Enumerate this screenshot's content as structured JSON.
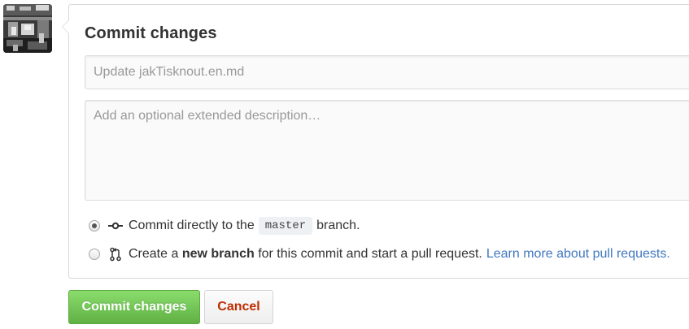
{
  "avatar": {
    "alt_icon": "user-avatar-photo"
  },
  "commit_form": {
    "title": "Commit changes",
    "summary_placeholder": "Update jakTisknout.en.md",
    "description_placeholder": "Add an optional extended description…",
    "options": [
      {
        "icon": "git-commit-icon",
        "selected": true,
        "text_before": "Commit directly to the",
        "branch_name": "master",
        "text_after": "branch."
      },
      {
        "icon": "git-pull-request-icon",
        "selected": false,
        "text_before": "Create a",
        "bold_text": "new branch",
        "text_after": "for this commit and start a pull request.",
        "link_text": "Learn more about pull requests."
      }
    ]
  },
  "buttons": {
    "commit_label": "Commit changes",
    "cancel_label": "Cancel"
  },
  "colors": {
    "primary_green": "#6cc644",
    "cancel_red": "#bd2c00",
    "link_blue": "#4078c0"
  }
}
